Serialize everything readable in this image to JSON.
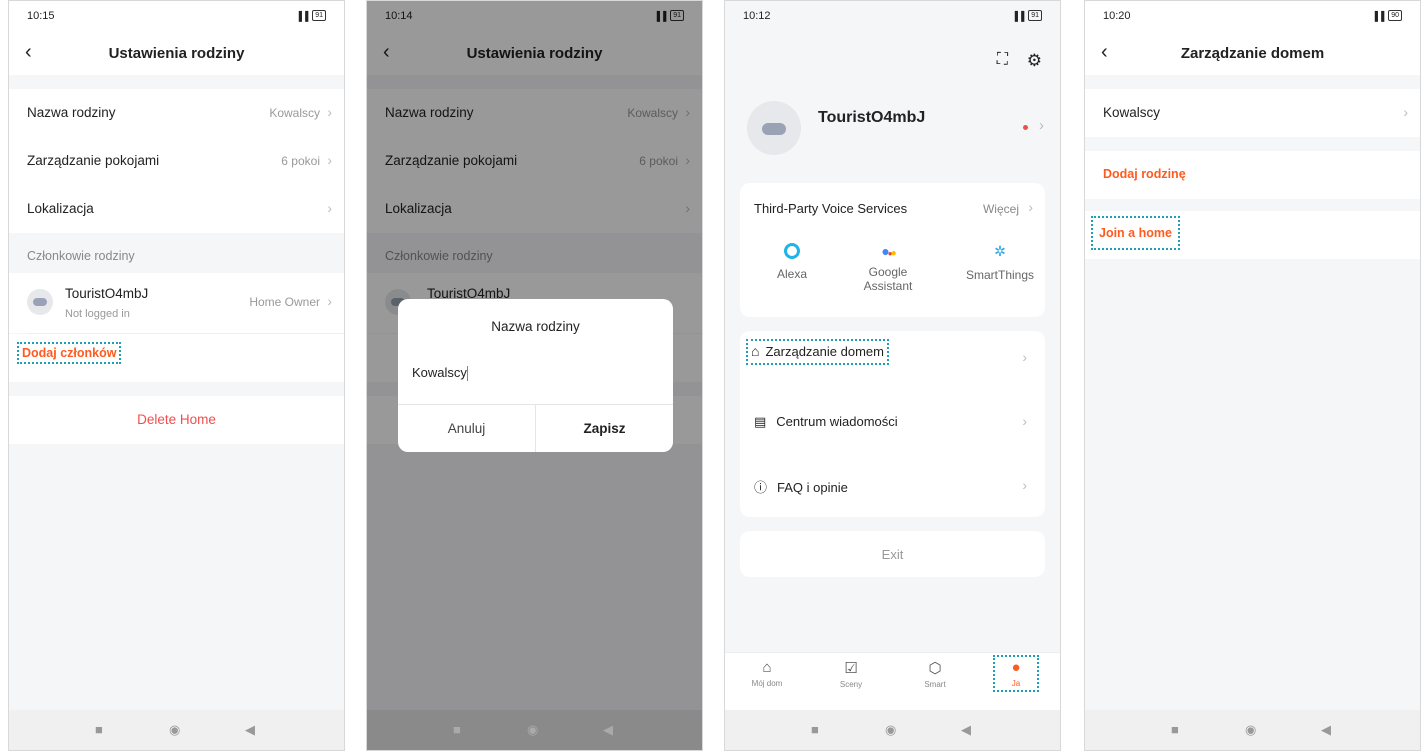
{
  "screen1": {
    "status": {
      "time": "10:15",
      "battery": "91"
    },
    "title": "Ustawienia rodziny",
    "rows": [
      {
        "label": "Nazwa rodziny",
        "value": "Kowalscy"
      },
      {
        "label": "Zarządzanie pokojami",
        "value": "6 pokoi"
      },
      {
        "label": "Lokalizacja",
        "value": ""
      }
    ],
    "members_section": "Członkowie rodziny",
    "member": {
      "name": "TouristO4mbJ",
      "status": "Not logged in",
      "role": "Home Owner"
    },
    "add_members": "Dodaj członków",
    "delete_home": "Delete Home"
  },
  "screen2": {
    "status": {
      "time": "10:14",
      "battery": "91"
    },
    "title": "Ustawienia rodziny",
    "rows": [
      {
        "label": "Nazwa rodziny",
        "value": "Kowalscy"
      },
      {
        "label": "Zarządzanie pokojami",
        "value": "6 pokoi"
      },
      {
        "label": "Lokalizacja",
        "value": ""
      }
    ],
    "members_section": "Członkowie rodziny",
    "member_name": "TouristO4mbJ",
    "dialog": {
      "title": "Nazwa rodziny",
      "input_value": "Kowalscy",
      "cancel": "Anuluj",
      "save": "Zapisz"
    }
  },
  "screen3": {
    "status": {
      "time": "10:12",
      "battery": "91"
    },
    "username": "TouristO4mbJ",
    "voice": {
      "title": "Third-Party Voice Services",
      "more": "Więcej",
      "items": [
        "Alexa",
        "Google Assistant",
        "SmartThings"
      ]
    },
    "menu": [
      "Zarządzanie domem",
      "Centrum wiadomości",
      "FAQ i opinie"
    ],
    "exit": "Exit",
    "tabs": [
      "Mój dom",
      "Sceny",
      "Smart",
      "Ja"
    ],
    "colors": {
      "accent": "#ff5a1f",
      "highlight": "#1ea0b4",
      "alexa": "#1fb4e6"
    }
  },
  "screen4": {
    "status": {
      "time": "10:20",
      "battery": "90"
    },
    "title": "Zarządzanie domem",
    "home_item": "Kowalscy",
    "add_home": "Dodaj rodzinę",
    "join_home": "Join a home"
  }
}
